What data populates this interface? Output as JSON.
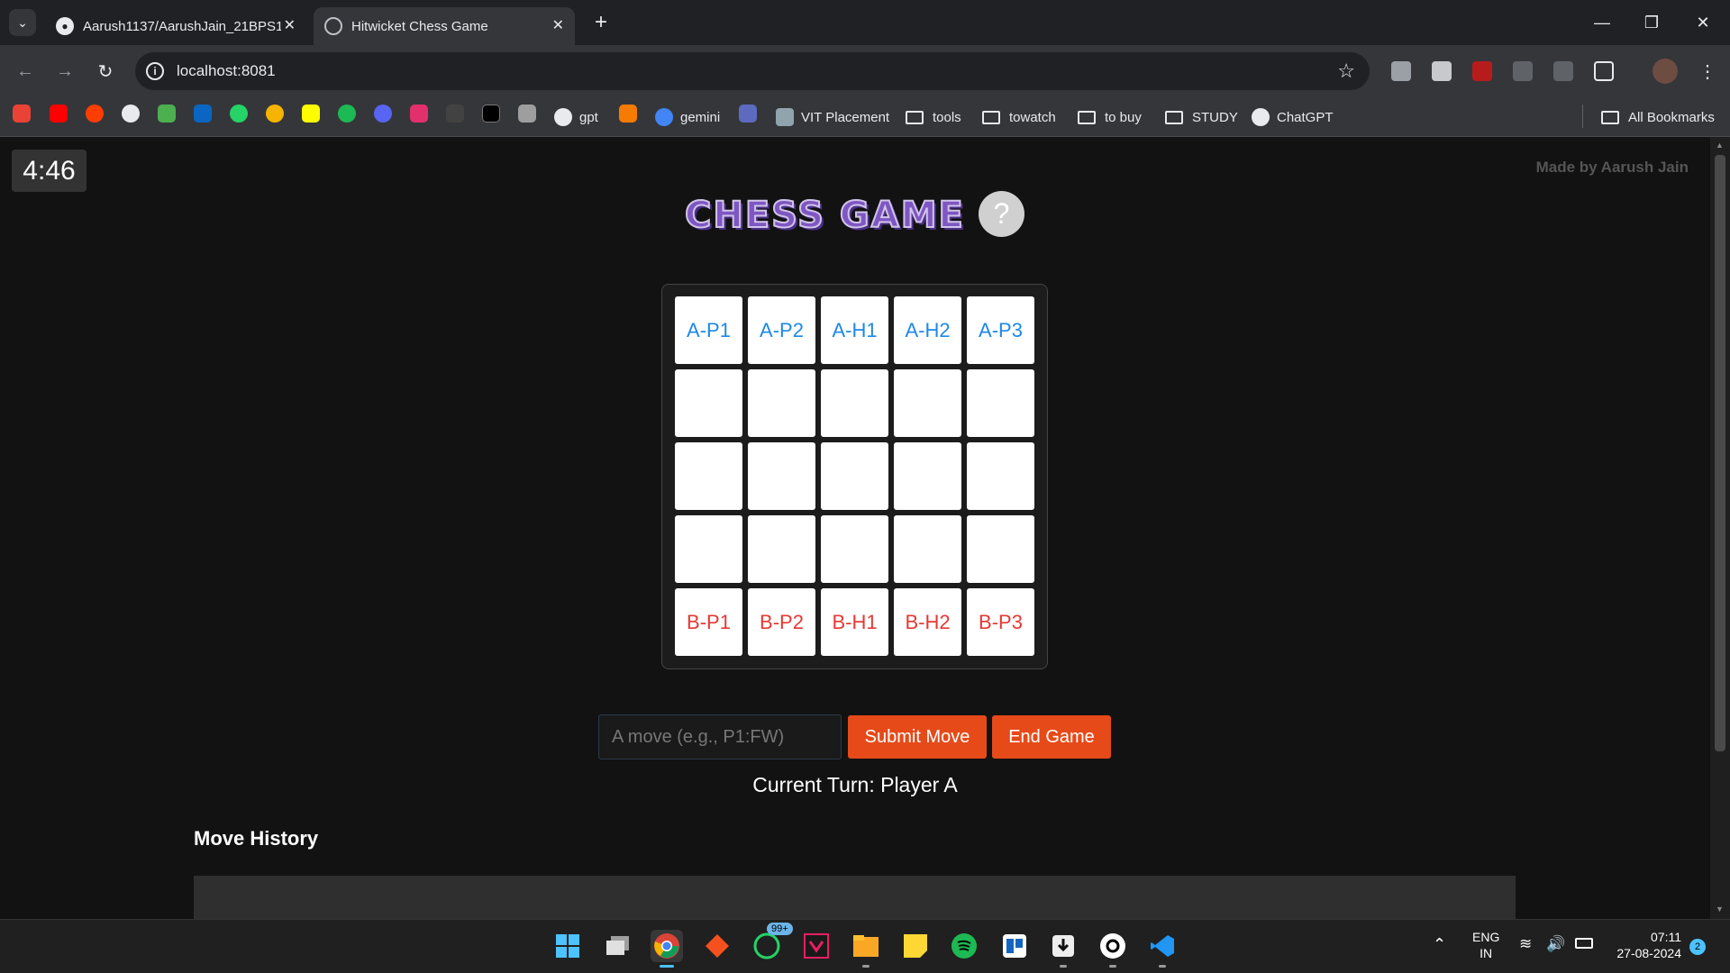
{
  "browser": {
    "tabs": [
      {
        "title": "Aarush1137/AarushJain_21BPS1",
        "active": false
      },
      {
        "title": "Hitwicket Chess Game",
        "active": true
      }
    ],
    "url": "localhost:8081",
    "bookmarks": [
      "gpt",
      "gemini",
      "VIT Placement",
      "tools",
      "towatch",
      "to buy",
      "STUDY",
      "ChatGPT"
    ],
    "all_bookmarks": "All Bookmarks"
  },
  "page": {
    "timer": "4:46",
    "made_by": "Made by Aarush Jain",
    "title": "CHESS GAME",
    "help_symbol": "?",
    "board": [
      [
        "A-P1",
        "A-P2",
        "A-H1",
        "A-H2",
        "A-P3"
      ],
      [
        "",
        "",
        "",
        "",
        ""
      ],
      [
        "",
        "",
        "",
        "",
        ""
      ],
      [
        "",
        "",
        "",
        "",
        ""
      ],
      [
        "B-P1",
        "B-P2",
        "B-H1",
        "B-H2",
        "B-P3"
      ]
    ],
    "move_input": {
      "placeholder": "A move (e.g., P1:FW)",
      "value": ""
    },
    "submit_label": "Submit Move",
    "end_label": "End Game",
    "current_turn": "Current Turn: Player A",
    "history_heading": "Move History"
  },
  "taskbar": {
    "whatsapp_badge": "99+",
    "lang_line1": "ENG",
    "lang_line2": "IN",
    "time": "07:11",
    "date": "27-08-2024",
    "notifications": "2"
  },
  "colors": {
    "player_a": "#1e88e5",
    "player_b": "#e53935",
    "button": "#e64a19",
    "title": "#7e57c2"
  }
}
